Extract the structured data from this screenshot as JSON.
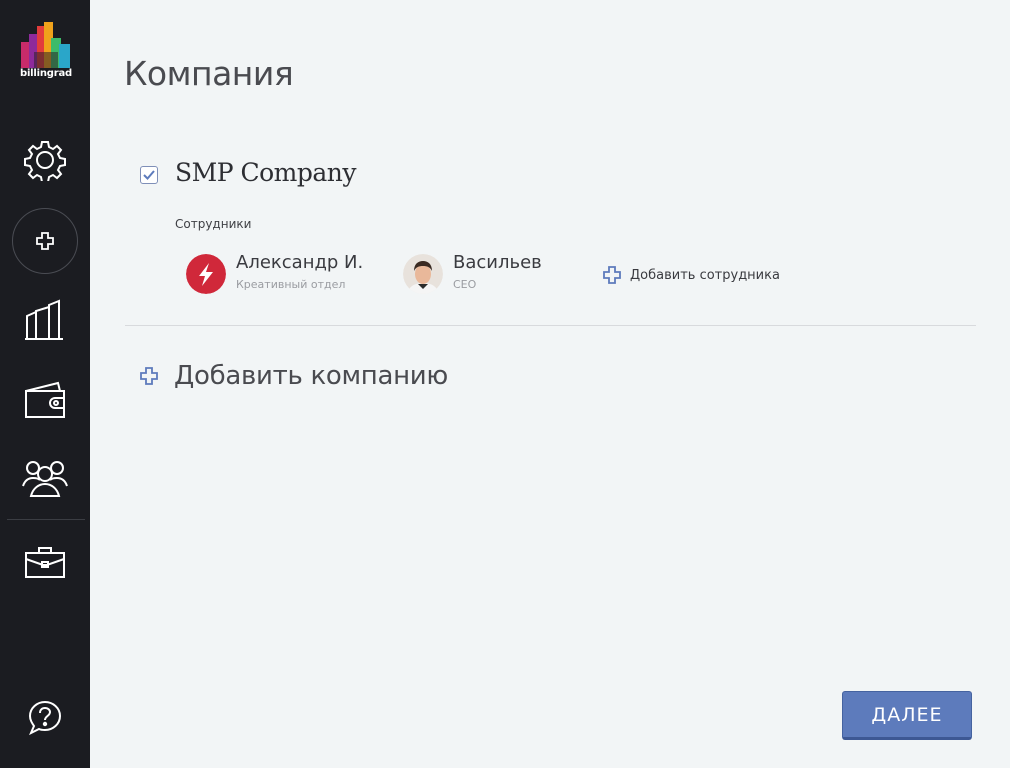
{
  "brand": {
    "name": "billingrad"
  },
  "sidebar": {
    "items": [
      {
        "icon": "gear-icon"
      },
      {
        "icon": "plus-icon"
      },
      {
        "icon": "buildings-icon"
      },
      {
        "icon": "wallet-icon"
      },
      {
        "icon": "people-icon"
      },
      {
        "icon": "briefcase-icon"
      },
      {
        "icon": "help-icon"
      }
    ]
  },
  "page": {
    "title": "Компания"
  },
  "company": {
    "name": "SMP Company",
    "checked": true,
    "employees_label": "Сотрудники",
    "employees": [
      {
        "name": "Александр И.",
        "role": "Креативный отдел",
        "avatar": "lightning-avatar"
      },
      {
        "name": "Васильев",
        "role": "CEO",
        "avatar": "photo-avatar"
      }
    ],
    "add_employee_label": "Добавить сотрудника"
  },
  "add_company_label": "Добавить компанию",
  "next_button_label": "ДАЛЕЕ",
  "colors": {
    "sidebar": "#1b1c21",
    "background": "#f2f5f6",
    "accent": "#5d7bbc",
    "avatar_red": "#d0283a"
  }
}
